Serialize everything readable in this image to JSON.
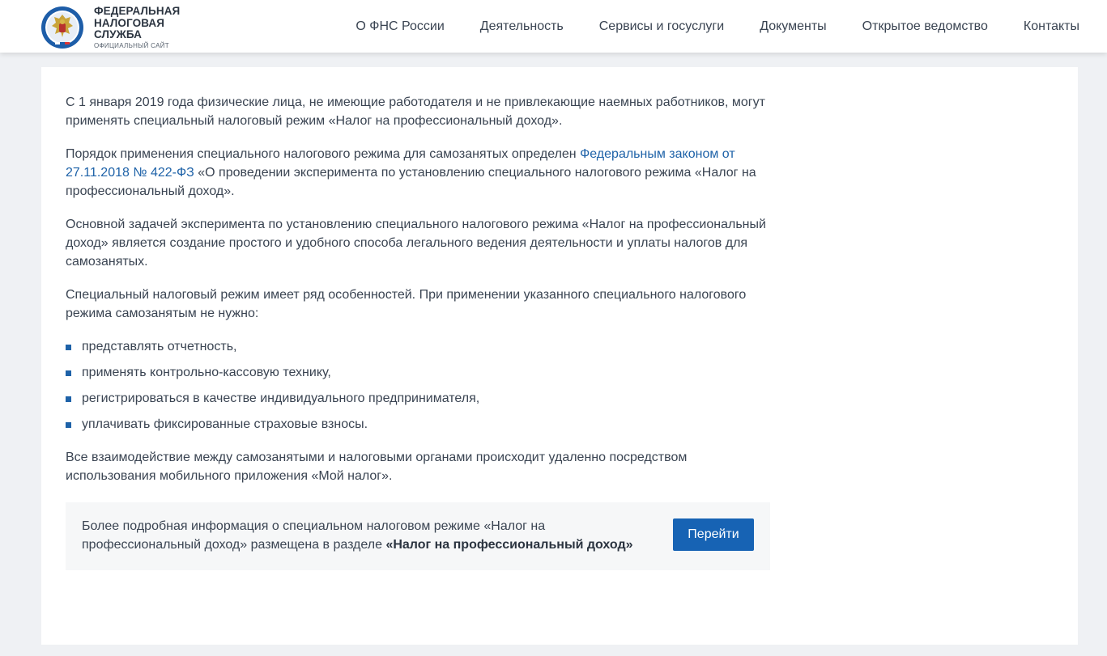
{
  "header": {
    "logo": {
      "line1": "ФЕДЕРАЛЬНАЯ",
      "line2": "НАЛОГОВАЯ СЛУЖБА",
      "subtitle": "ОФИЦИАЛЬНЫЙ САЙТ"
    },
    "nav": [
      {
        "label": "О ФНС России"
      },
      {
        "label": "Деятельность"
      },
      {
        "label": "Сервисы и госуслуги"
      },
      {
        "label": "Документы"
      },
      {
        "label": "Открытое ведомство"
      },
      {
        "label": "Контакты"
      }
    ]
  },
  "content": {
    "p1": "С 1 января 2019 года физические лица, не имеющие работодателя и не привлекающие наемных работников, могут применять специальный налоговый режим «Налог на профессиональный доход».",
    "p2_before": "Порядок применения специального налогового режима для самозанятых определен ",
    "p2_link": "Федеральным законом от 27.11.2018 № 422-ФЗ",
    "p2_after": " «О проведении эксперимента по установлению специального налогового режима «Налог на профессиональный доход».",
    "p3": "Основной задачей эксперимента по установлению специального налогового режима «Налог на профессиональный доход» является создание простого и удобного способа легального ведения деятельности и уплаты налогов для самозанятых.",
    "p4": "Специальный налоговый режим имеет ряд особенностей. При применении указанного специального налогового режима самозанятым не нужно:",
    "list": [
      "представлять отчетность,",
      "применять контрольно-кассовую технику,",
      "регистрироваться в качестве индивидуального предпринимателя,",
      "уплачивать фиксированные страховые взносы."
    ],
    "p5": "Все взаимодействие между самозанятыми и налоговыми органами происходит удаленно посредством использования мобильного приложения «Мой налог»."
  },
  "info_box": {
    "text": "Более подробная информация о специальном налоговом режиме «Налог на профессиональный доход» размещена в разделе ",
    "bold": "«Налог на профессиональный доход»",
    "button_label": "Перейти"
  },
  "colors": {
    "accent": "#1763b4",
    "link": "#1e62a8",
    "background": "#eff1f4"
  }
}
